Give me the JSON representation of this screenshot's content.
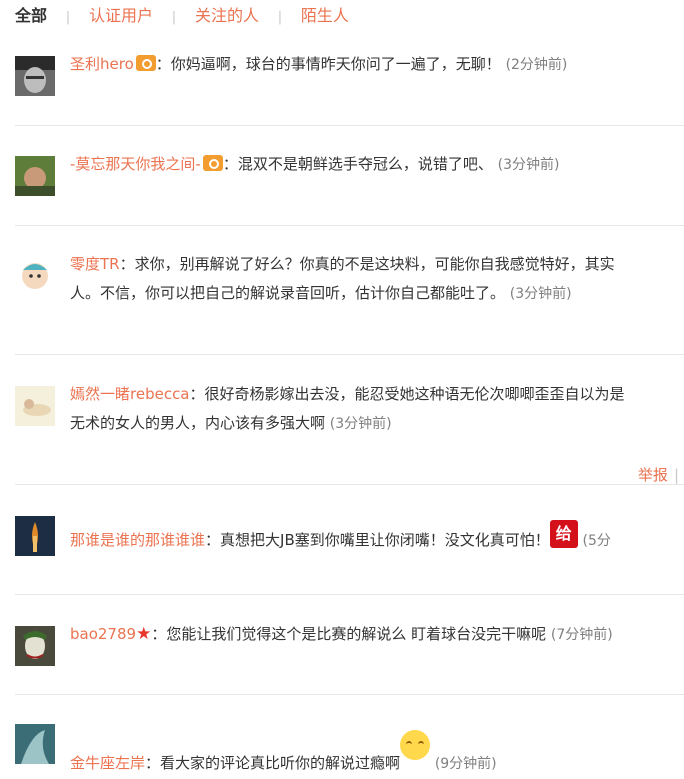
{
  "tabs": {
    "all": "全部",
    "verified": "认证用户",
    "following": "关注的人",
    "strangers": "陌生人",
    "separator": "|"
  },
  "comments": [
    {
      "user": "圣利hero",
      "text": "：你妈逼啊，球台的事情昨天你问了一遍了，无聊！",
      "time": "(2分钟前)"
    },
    {
      "user": "-莫忘那天你我之间-",
      "text": "：混双不是朝鲜选手夺冠么，说错了吧、",
      "time": "(3分钟前)"
    },
    {
      "user": "零度TR",
      "text": "：求你，别再解说了好么？你真的不是这块料，可能你自我感觉特好，其实",
      "text2": "人。不信，你可以把自己的解说录音回听，估计你自己都能吐了。",
      "time": "(3分钟前)"
    },
    {
      "user": "嫣然一睹rebecca",
      "text": "：很好奇杨影嫁出去没，能忍受她这种语无伦次唧唧歪歪自以为是",
      "text2": "无术的女人的男人，内心该有多强大啊",
      "time": "(3分钟前)",
      "report": "举报",
      "report_sep": "|"
    },
    {
      "user": "那谁是谁的那谁谁谁",
      "text": "：真想把大JB塞到你嘴里让你闭嘴！没文化真可怕！",
      "time": "(5分",
      "gift": "给"
    },
    {
      "user": "bao2789",
      "text": "：您能让我们觉得这个是比赛的解说么 盯着球台没完干嘛呢",
      "time": "(7分钟前)"
    },
    {
      "user": "金牛座左岸",
      "text": "：看大家的评论真比听你的解说过瘾啊",
      "time": "(9分钟前)"
    }
  ],
  "colors": {
    "accent": "#eb7350",
    "muted": "#808080",
    "divider": "#e6e6e6"
  }
}
